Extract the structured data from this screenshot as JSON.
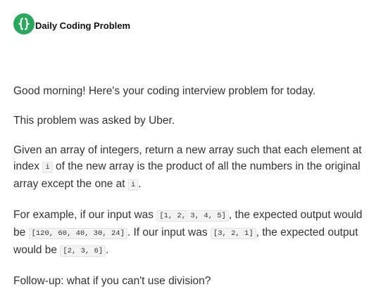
{
  "header": {
    "brand": "Daily Coding Problem",
    "logo_icon": "dcp-logo-icon",
    "logo_color": "#27a85c"
  },
  "email": {
    "greeting": "Good morning! Here's your coding interview problem for today.",
    "asked_by": "This problem was asked by Uber.",
    "problem": {
      "t1": "Given an array of integers, return a new array such that each element at index ",
      "c1": "i",
      "t2": " of the new array is the product of all the numbers in the original array except the one at ",
      "c2": "i",
      "t3": "."
    },
    "example": {
      "t1": "For example, if our input was ",
      "c1": "[1, 2, 3, 4, 5]",
      "t2": ", the expected output would be ",
      "c2": "[120, 60, 40, 30, 24]",
      "t3": ". If our input was ",
      "c3": "[3, 2, 1]",
      "t4": ", the expected output would be ",
      "c4": "[2, 3, 6]",
      "t5": "."
    },
    "followup": "Follow-up: what if you can't use division?"
  }
}
